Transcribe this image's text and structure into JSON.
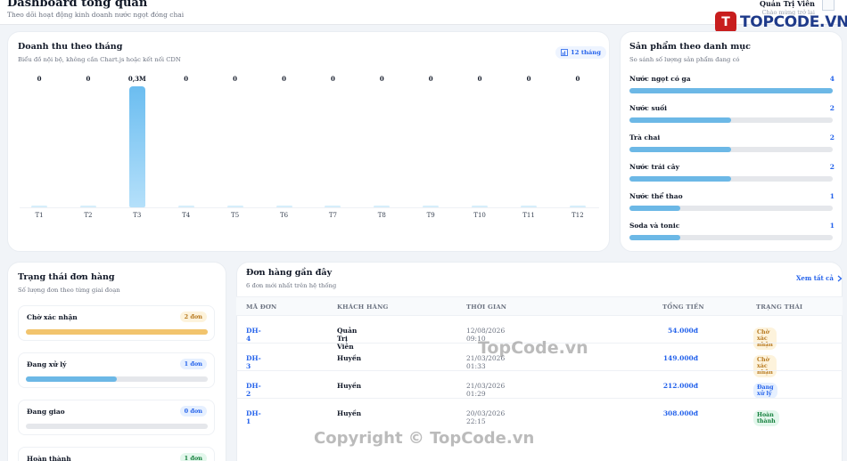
{
  "header": {
    "title": "Dashboard tổng quan",
    "subtitle": "Theo dõi hoạt động kinh doanh nước ngọt đóng chai",
    "user_name": "Quản Trị Viên",
    "user_role": "Chào mừng trở lại"
  },
  "logo": {
    "mark": "TC",
    "text": "TOPCODE.VN"
  },
  "revenue": {
    "title": "Doanh thu theo tháng",
    "subtitle": "Biểu đồ nội bộ, không cần Chart.js hoặc kết nối CDN",
    "pill_label": "12 tháng"
  },
  "chart_data": {
    "type": "bar",
    "title": "Doanh thu theo tháng",
    "categories": [
      "T1",
      "T2",
      "T3",
      "T4",
      "T5",
      "T6",
      "T7",
      "T8",
      "T9",
      "T10",
      "T11",
      "T12"
    ],
    "values": [
      0,
      0,
      0.3,
      0,
      0,
      0,
      0,
      0,
      0,
      0,
      0,
      0
    ],
    "value_labels": [
      "0",
      "0",
      "0,3M",
      "0",
      "0",
      "0",
      "0",
      "0",
      "0",
      "0",
      "0",
      "0"
    ],
    "ylim": [
      0,
      0.3
    ],
    "grid": false,
    "legend": "none"
  },
  "categories": {
    "title": "Sản phẩm theo danh mục",
    "subtitle": "So sánh số lượng sản phẩm đang có",
    "max": 4,
    "items": [
      {
        "name": "Nước ngọt có ga",
        "count": 4
      },
      {
        "name": "Nước suối",
        "count": 2
      },
      {
        "name": "Trà chai",
        "count": 2
      },
      {
        "name": "Nước trái cây",
        "count": 2
      },
      {
        "name": "Nước thể thao",
        "count": 1
      },
      {
        "name": "Soda và tonic",
        "count": 1
      }
    ]
  },
  "order_status": {
    "title": "Trạng thái đơn hàng",
    "subtitle": "Số lượng đơn theo từng giai đoạn",
    "items": [
      {
        "name": "Chờ xác nhận",
        "badge": "2 đơn",
        "fraction": 1.0,
        "color": "#f2c46d",
        "badge_bg": "#fdf3dc",
        "badge_color": "#b7791f"
      },
      {
        "name": "Đang xử lý",
        "badge": "1 đơn",
        "fraction": 0.5,
        "color": "#6cb8e6",
        "badge_bg": "#e6f0ff",
        "badge_color": "#2563eb"
      },
      {
        "name": "Đang giao",
        "badge": "0 đơn",
        "fraction": 0.0,
        "color": "#6cb8e6",
        "badge_bg": "#e6f0ff",
        "badge_color": "#2563eb"
      },
      {
        "name": "Hoàn thành",
        "badge": "1 đơn",
        "fraction": 0.5,
        "color": "#34c38f",
        "badge_bg": "#e3f7ec",
        "badge_color": "#15803d"
      }
    ]
  },
  "recent_orders": {
    "title": "Đơn hàng gần đây",
    "subtitle": "6 đơn mới nhất trên hệ thống",
    "view_all": "Xem tất cả",
    "columns": [
      "MÃ ĐƠN",
      "KHÁCH HÀNG",
      "THỜI GIAN",
      "TỔNG TIỀN",
      "TRẠNG THÁI"
    ],
    "rows": [
      {
        "id": "DH-4",
        "customer": "Quản Trị Viên",
        "time": "12/08/2026 09:10",
        "total": "54.000đ",
        "status": "Chờ xác nhận",
        "status_bg": "#fdf3dc",
        "status_color": "#b7791f"
      },
      {
        "id": "DH-3",
        "customer": "Huyền",
        "time": "21/03/2026 01:33",
        "total": "149.000đ",
        "status": "Chờ xác nhận",
        "status_bg": "#fdf3dc",
        "status_color": "#b7791f"
      },
      {
        "id": "DH-2",
        "customer": "Huyền",
        "time": "21/03/2026 01:29",
        "total": "212.000đ",
        "status": "Đang xử lý",
        "status_bg": "#e6f0ff",
        "status_color": "#2563eb"
      },
      {
        "id": "DH-1",
        "customer": "Huyền",
        "time": "20/03/2026 22:15",
        "total": "308.000đ",
        "status": "Hoàn thành",
        "status_bg": "#e3f7ec",
        "status_color": "#15803d"
      }
    ]
  },
  "watermarks": {
    "center": "TopCode.vn",
    "bottom": "Copyright © TopCode.vn"
  },
  "icons": {
    "pill": "bar-chart-icon",
    "view_all": "chevron-right-icon",
    "avatar": "user-avatar-icon"
  }
}
